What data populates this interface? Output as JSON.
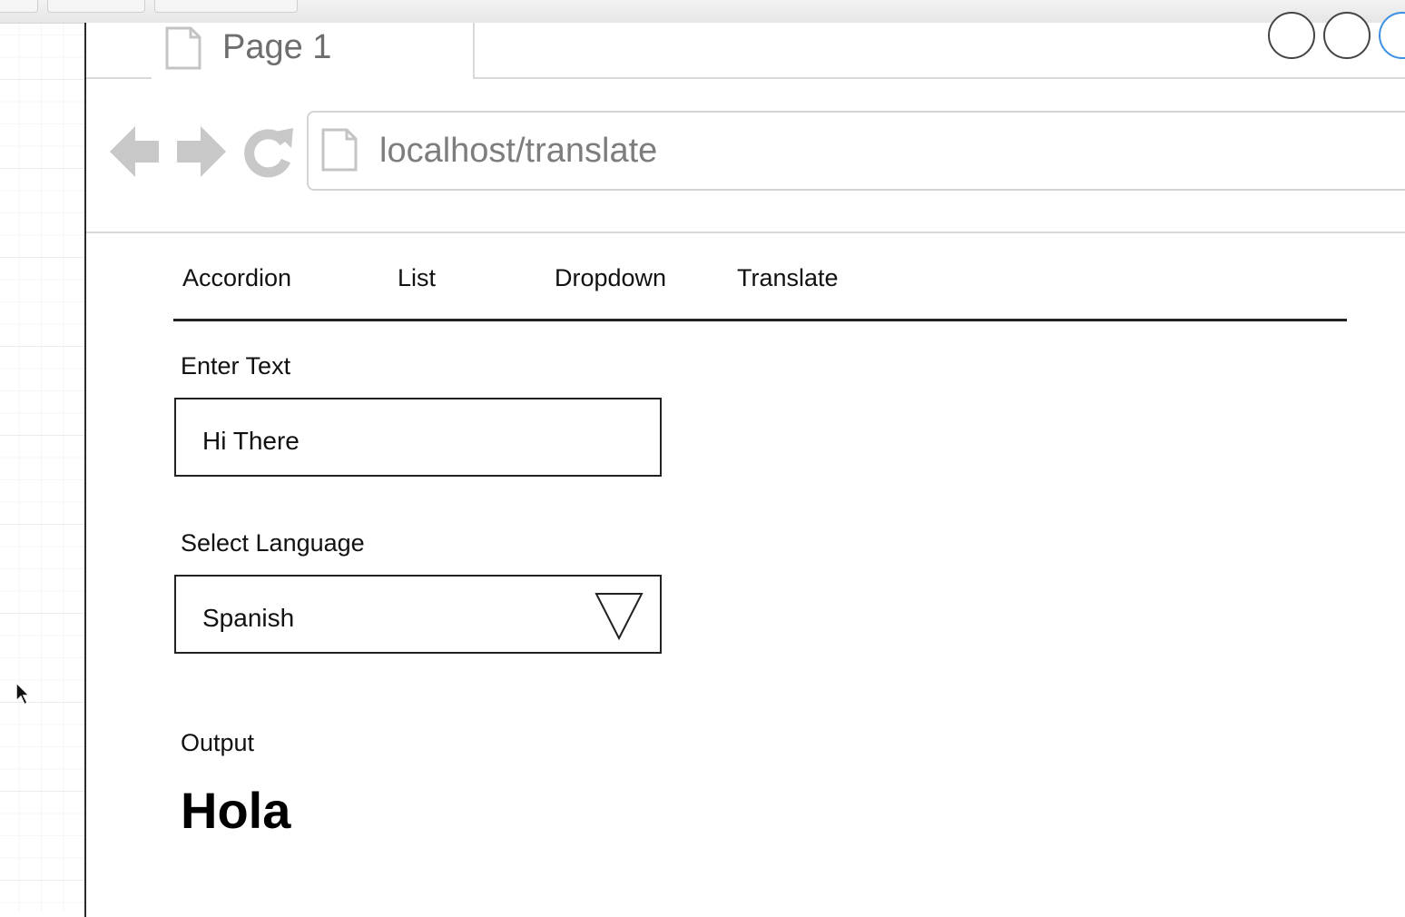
{
  "browser": {
    "tab_title": "Page 1",
    "url": "localhost/translate"
  },
  "menu": {
    "items": [
      {
        "label": "Accordion"
      },
      {
        "label": "List"
      },
      {
        "label": "Dropdown"
      },
      {
        "label": "Translate"
      }
    ]
  },
  "form": {
    "text_label": "Enter Text",
    "text_value": "Hi There",
    "language_label": "Select Language",
    "language_value": "Spanish"
  },
  "output": {
    "label": "Output",
    "value": "Hola"
  },
  "icons": [
    "page-icon",
    "back-arrow-icon",
    "forward-arrow-icon",
    "reload-icon",
    "dropdown-triangle-icon",
    "mouse-cursor-icon"
  ],
  "colors": {
    "chrome_gray": "#d9d9d9",
    "icon_gray": "#c8c8c8",
    "text": "#111111"
  }
}
